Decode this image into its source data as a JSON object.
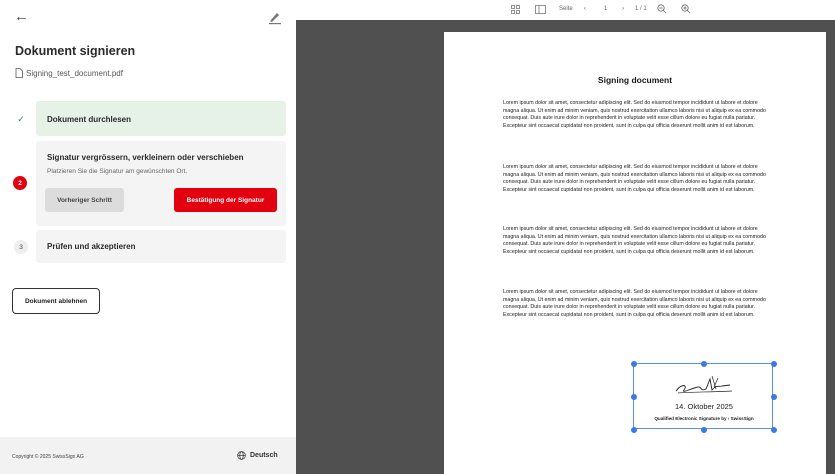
{
  "sidebar": {
    "title": "Dokument signieren",
    "file_name": "Signing_test_document.pdf",
    "steps": [
      {
        "number": "",
        "title": "Dokument durchlesen"
      },
      {
        "number": "2",
        "title": "Signatur vergrössern, verkleinern oder verschieben",
        "description": "Platzieren Sie die Signatur am gewünschten Ort.",
        "prev_label": "Vorheriger Schritt",
        "confirm_label": "Bestätigung der Signatur"
      },
      {
        "number": "3",
        "title": "Prüfen und akzeptieren"
      }
    ],
    "reject_label": "Dokument ablehnen",
    "footer": {
      "copyright": "Copyright © 2025 SwissSign AG",
      "language": "Deutsch"
    }
  },
  "toolbar": {
    "page_label": "Seite",
    "page_current": "1",
    "page_total": "1 / 1"
  },
  "document": {
    "title": "Signing document",
    "paragraphs": [
      "Lorem ipsum dolor sit amet, consectetur adipiscing elit. Sed do eiusmod tempor incididunt ut labore et dolore magna aliqua. Ut enim ad minim veniam, quis nostrud exercitation ullamco laboris nisi ut aliquip ex ea commodo consequat. Duis aute irure dolor in reprehenderit in voluptate velit esse cillum dolore eu fugiat nulla pariatur. Excepteur sint occaecat cupidatat non proident, sunt in culpa qui officia deserunt mollit anim id est laborum.",
      "Lorem ipsum dolor sit amet, consectetur adipiscing elit. Sed do eiusmod tempor incididunt ut labore et dolore magna aliqua. Ut enim ad minim veniam, quis nostrud exercitation ullamco laboris nisi ut aliquip ex ea commodo consequat. Duis aute irure dolor in reprehenderit in voluptate velit esse cillum dolore eu fugiat nulla pariatur. Excepteur sint occaecat cupidatat non proident, sunt in culpa qui officia deserunt mollit anim id est laborum.",
      "Lorem ipsum dolor sit amet, consectetur adipiscing elit. Sed do eiusmod tempor incididunt ut labore et dolore magna aliqua. Ut enim ad minim veniam, quis nostrud exercitation ullamco laboris nisi ut aliquip ex ea commodo consequat. Duis aute irure dolor in reprehenderit in voluptate velit esse cillum dolore eu fugiat nulla pariatur. Excepteur sint occaecat cupidatat non proident, sunt in culpa qui officia deserunt mollit anim id est laborum.",
      "Lorem ipsum dolor sit amet, consectetur adipiscing elit. Sed do eiusmod tempor incididunt ut labore et dolore magna aliqua. Ut enim ad minim veniam, quis nostrud exercitation ullamco laboris nisi ut aliquip ex ea commodo consequat. Duis aute irure dolor in reprehenderit in voluptate velit esse cillum dolore eu fugiat nulla pariatur. Excepteur sint occaecat cupidatat non proident, sunt in culpa qui officia deserunt mollit anim id est laborum."
    ],
    "signature": {
      "date": "14. Oktober 2025",
      "qualifier": "Qualified Electronic Signature by",
      "brand": "SwissSign"
    }
  },
  "colors": {
    "accent": "#e3000f",
    "done_bg": "#e6f1e8",
    "selection": "#3b78ec",
    "viewer_bg": "#505050"
  },
  "icons": [
    "back-arrow-icon",
    "edit-pen-icon",
    "file-icon",
    "check-icon",
    "thumbnails-icon",
    "sidebar-toggle-icon",
    "prev-page-icon",
    "next-page-icon",
    "zoom-out-icon",
    "zoom-in-icon",
    "globe-icon"
  ]
}
